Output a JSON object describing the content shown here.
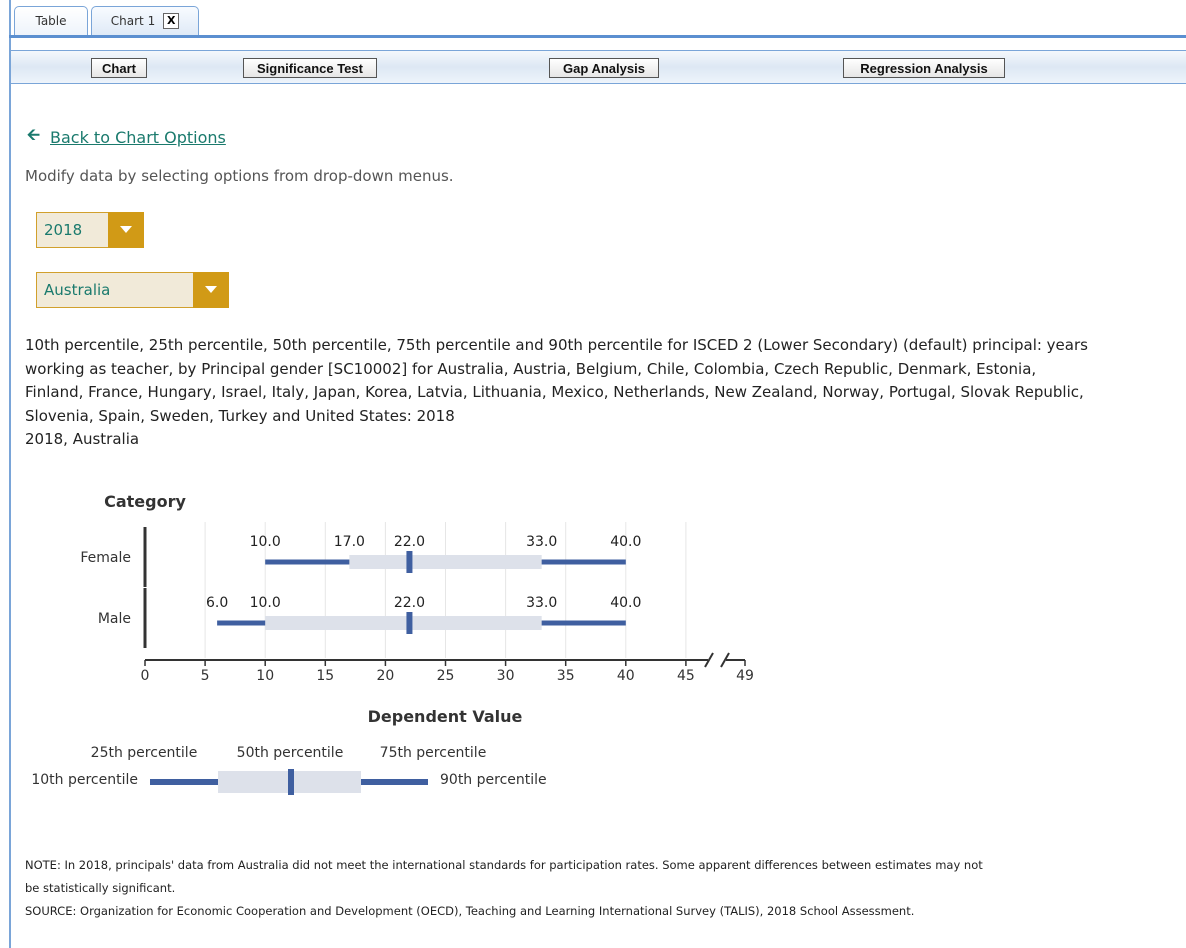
{
  "tabs": {
    "table": "Table",
    "chart": "Chart 1",
    "close": "X"
  },
  "toolbar": {
    "chart": "Chart",
    "significance": "Significance Test",
    "gap": "Gap Analysis",
    "regression": "Regression Analysis"
  },
  "back_link": "Back to Chart Options",
  "instructions": "Modify data by selecting options from drop-down menus.",
  "dropdowns": {
    "year": "2018",
    "country": "Australia"
  },
  "description": {
    "main": "10th percentile, 25th percentile, 50th percentile, 75th percentile and 90th percentile for ISCED 2 (Lower Secondary) (default) principal: years working as teacher, by Principal gender [SC10002] for Australia, Austria, Belgium, Chile, Colombia, Czech Republic, Denmark, Estonia, Finland, France, Hungary, Israel, Italy, Japan, Korea, Latvia, Lithuania, Mexico, Netherlands, New Zealand, Norway, Portugal, Slovak Republic, Slovenia, Spain, Sweden, Turkey and United States: 2018",
    "sub": "2018, Australia"
  },
  "chart_data": {
    "type": "box",
    "title": "",
    "ylabel": "Category",
    "xlabel": "Dependent Value",
    "x_ticks": [
      "0",
      "5",
      "10",
      "15",
      "20",
      "25",
      "30",
      "35",
      "40",
      "45",
      "49"
    ],
    "axis_break": "between 45 and 49",
    "xlim": [
      0,
      49
    ],
    "grid": true,
    "categories": [
      "Female",
      "Male"
    ],
    "series": [
      {
        "category": "Female",
        "p10": 10.0,
        "p25": 17.0,
        "p50": 22.0,
        "p75": 33.0,
        "p90": 40.0,
        "labels": [
          "10.0",
          "17.0",
          "22.0",
          "33.0",
          "40.0"
        ]
      },
      {
        "category": "Male",
        "p10": 6.0,
        "p25": 10.0,
        "p50": 22.0,
        "p75": 33.0,
        "p90": 40.0,
        "labels": [
          "6.0",
          "10.0",
          "22.0",
          "33.0",
          "40.0"
        ]
      }
    ],
    "legend": {
      "p10": "10th percentile",
      "p25": "25th percentile",
      "p50": "50th percentile",
      "p75": "75th percentile",
      "p90": "90th percentile"
    },
    "colors": {
      "whisker": "#3f5fa0",
      "box": "#dde1ea",
      "median": "#3f5fa0",
      "axis": "#333333",
      "grid": "#e6e6e6"
    }
  },
  "notes": {
    "note": "NOTE: In 2018, principals' data from Australia did not meet the international standards for participation rates. Some apparent differences between estimates may not be statistically significant.",
    "source": "SOURCE: Organization for Economic Cooperation and Development (OECD), Teaching and Learning International Survey (TALIS), 2018 School Assessment."
  }
}
